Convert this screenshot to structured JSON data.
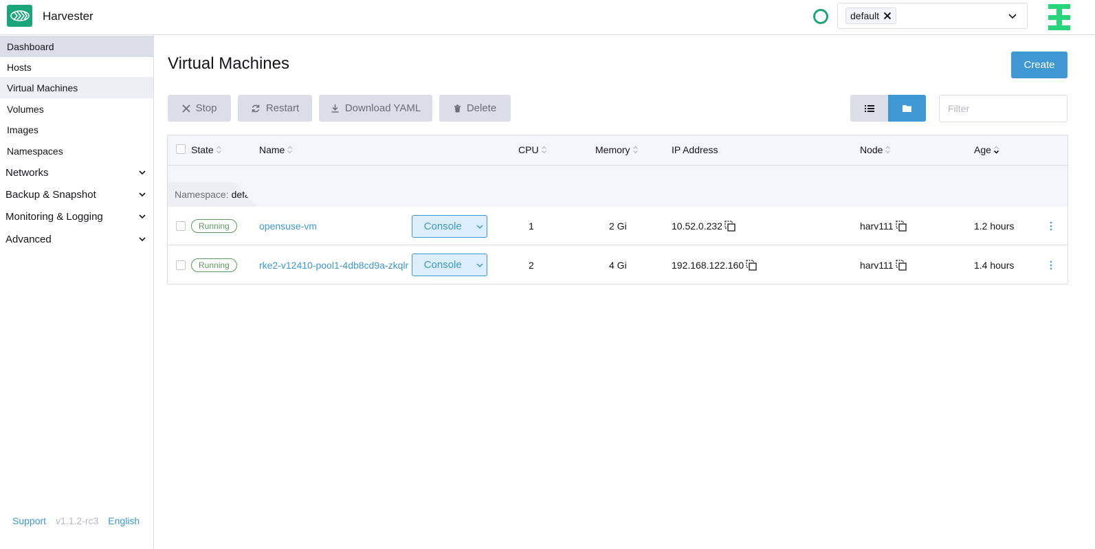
{
  "header": {
    "app_title": "Harvester",
    "namespace_chip": "default",
    "colors": {
      "brand": "#1aa57b",
      "accent": "#3d98d3"
    }
  },
  "sidebar": {
    "items": [
      {
        "label": "Dashboard"
      },
      {
        "label": "Hosts"
      },
      {
        "label": "Virtual Machines"
      },
      {
        "label": "Volumes"
      },
      {
        "label": "Images"
      },
      {
        "label": "Namespaces"
      }
    ],
    "groups": [
      {
        "label": "Networks"
      },
      {
        "label": "Backup & Snapshot"
      },
      {
        "label": "Monitoring & Logging"
      },
      {
        "label": "Advanced"
      }
    ],
    "footer": {
      "support": "Support",
      "version": "v1.1.2-rc3",
      "language": "English"
    }
  },
  "main": {
    "title": "Virtual Machines",
    "create_label": "Create",
    "bulk_actions": {
      "stop": "Stop",
      "restart": "Restart",
      "download_yaml": "Download YAML",
      "delete": "Delete"
    },
    "filter_placeholder": "Filter",
    "table": {
      "columns": {
        "state": "State",
        "name": "Name",
        "cpu": "CPU",
        "memory": "Memory",
        "ip": "IP Address",
        "node": "Node",
        "age": "Age"
      },
      "group_prefix": "Namespace:",
      "group_name": "default",
      "rows": [
        {
          "state": "Running",
          "name": "opensuse-vm",
          "console": "Console",
          "cpu": "1",
          "memory": "2 Gi",
          "ip": "10.52.0.232",
          "node": "harv111",
          "age": "1.2 hours"
        },
        {
          "state": "Running",
          "name": "rke2-v12410-pool1-4db8cd9a-zkqlr",
          "console": "Console",
          "cpu": "2",
          "memory": "4 Gi",
          "ip": "192.168.122.160",
          "node": "harv111",
          "age": "1.4 hours"
        }
      ]
    }
  }
}
